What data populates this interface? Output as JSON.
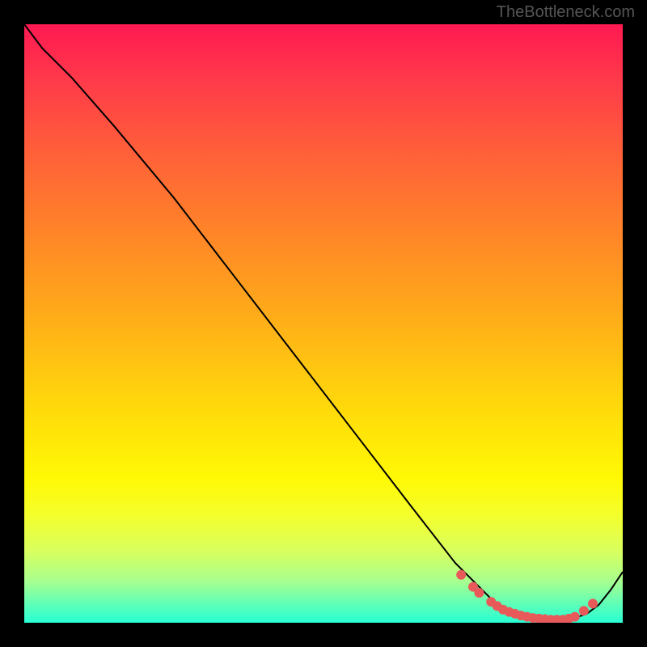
{
  "watermark": "TheBottleneck.com",
  "chart_data": {
    "type": "line",
    "title": "",
    "xlabel": "",
    "ylabel": "",
    "xlim": [
      0,
      100
    ],
    "ylim": [
      0,
      100
    ],
    "curve_x": [
      0,
      3,
      8,
      15,
      25,
      35,
      45,
      55,
      65,
      72,
      76,
      79,
      82,
      85,
      88,
      90,
      92,
      94,
      96,
      98,
      100
    ],
    "curve_y": [
      100,
      96,
      91,
      83,
      71,
      58,
      45,
      32,
      19,
      10,
      6,
      3,
      1.5,
      0.8,
      0.5,
      0.5,
      0.8,
      1.5,
      3,
      5.5,
      8.5
    ],
    "highlighted_points_x": [
      73,
      75,
      76,
      78,
      79,
      80,
      81,
      82,
      83,
      84,
      85,
      86,
      87,
      88,
      89,
      90,
      91,
      92,
      93.5,
      95
    ],
    "highlighted_points_y": [
      8,
      6,
      5,
      3.5,
      2.8,
      2.2,
      1.8,
      1.5,
      1.2,
      1,
      0.8,
      0.7,
      0.6,
      0.5,
      0.5,
      0.5,
      0.7,
      1,
      2,
      3.2
    ]
  }
}
